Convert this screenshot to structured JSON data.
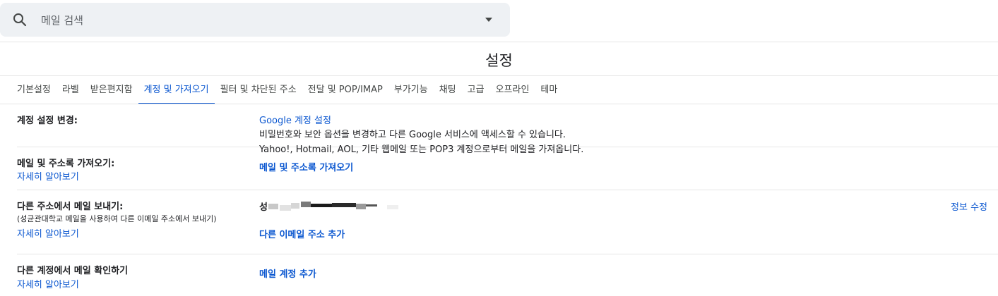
{
  "search": {
    "placeholder": "메일 검색",
    "icon": "search-icon",
    "options_icon": "chevron-down-icon"
  },
  "page": {
    "title": "설정"
  },
  "tabs": [
    {
      "label": "기본설정",
      "active": false
    },
    {
      "label": "라벨",
      "active": false
    },
    {
      "label": "받은편지함",
      "active": false
    },
    {
      "label": "계정 및 가져오기",
      "active": true
    },
    {
      "label": "필터 및 차단된 주소",
      "active": false
    },
    {
      "label": "전달 및 POP/IMAP",
      "active": false
    },
    {
      "label": "부가기능",
      "active": false
    },
    {
      "label": "채팅",
      "active": false
    },
    {
      "label": "고급",
      "active": false
    },
    {
      "label": "오프라인",
      "active": false
    },
    {
      "label": "테마",
      "active": false
    }
  ],
  "sections": {
    "change_account": {
      "label": "계정 설정 변경:",
      "link": "Google 계정 설정",
      "description": "비밀번호와 보안 옵션을 변경하고 다른 Google 서비스에 액세스할 수 있습니다."
    },
    "import": {
      "label": "메일 및 주소록 가져오기:",
      "learn_more": "자세히 알아보기",
      "description": "Yahoo!, Hotmail, AOL, 기타 웹메일 또는 POP3 계정으로부터 메일을 가져옵니다.",
      "action": "메일 및 주소록 가져오기"
    },
    "send_as": {
      "label": "다른 주소에서 메일 보내기:",
      "sublabel": "(성균관대학교 메일을 사용하여 다른 이메일 주소에서 보내기)",
      "learn_more": "자세히 알아보기",
      "email_prefix": "성",
      "edit": "정보 수정",
      "action": "다른 이메일 주소 추가"
    },
    "check_mail": {
      "label": "다른 계정에서 메일 확인하기",
      "learn_more": "자세히 알아보기",
      "action": "메일 계정 추가"
    }
  },
  "colors": {
    "link": "#0b57d0",
    "search_bg": "#eef1f4",
    "divider": "#e6e6e6"
  }
}
